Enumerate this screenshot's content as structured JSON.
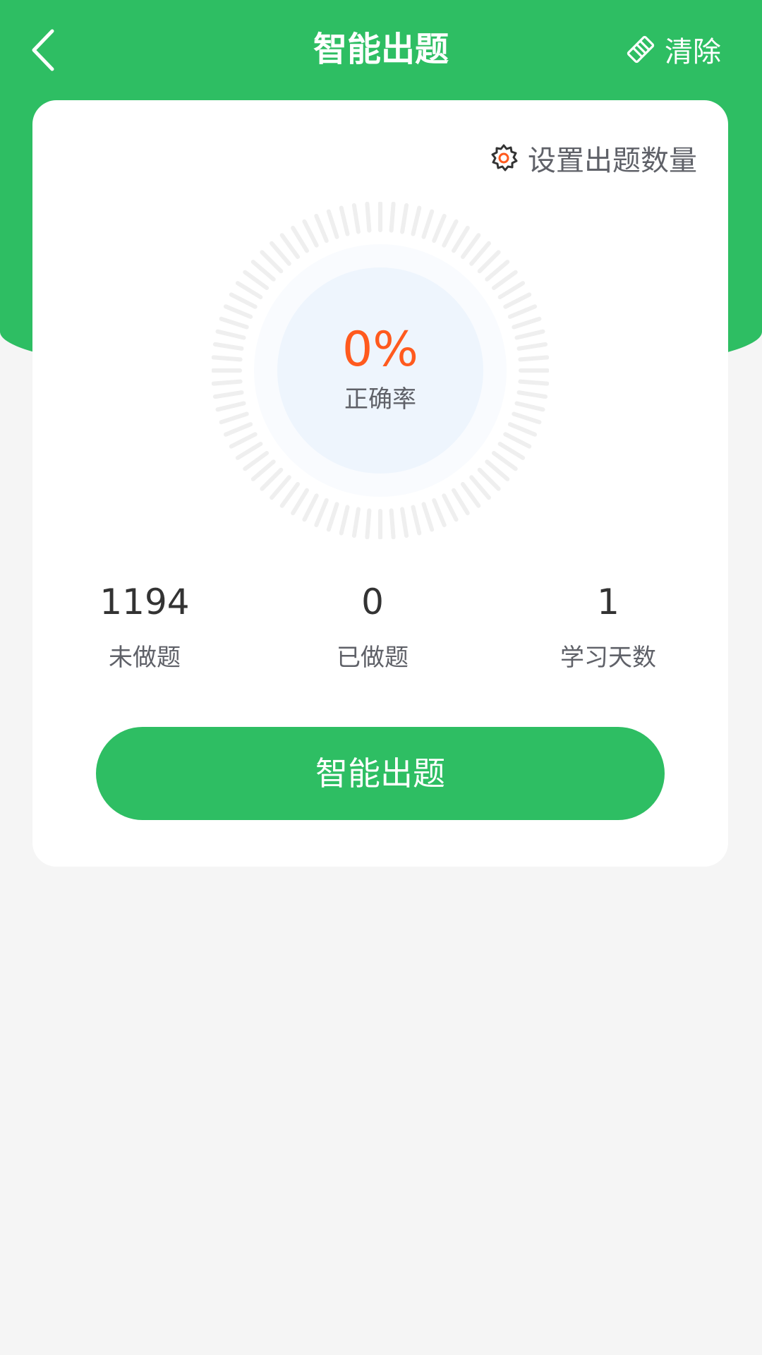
{
  "header": {
    "title": "智能出题",
    "clear_label": "清除"
  },
  "card": {
    "settings_label": "设置出题数量",
    "accuracy": {
      "value": "0%",
      "label": "正确率"
    },
    "stats": [
      {
        "value": "1194",
        "label": "未做题"
      },
      {
        "value": "0",
        "label": "已做题"
      },
      {
        "value": "1",
        "label": "学习天数"
      }
    ],
    "cta_label": "智能出题"
  },
  "colors": {
    "brand_green": "#2ebe63",
    "accent_orange": "#ff5a1e",
    "background": "#f5f5f5"
  },
  "icons": {
    "back": "chevron-left-icon",
    "clear": "eraser-icon",
    "settings": "gear-icon"
  }
}
